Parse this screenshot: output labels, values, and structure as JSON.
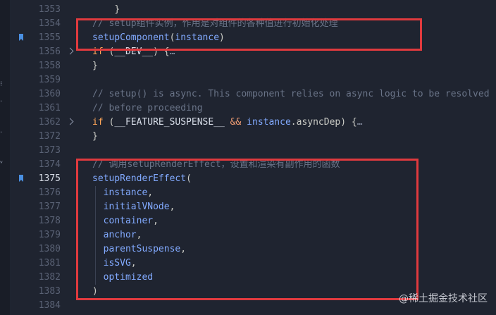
{
  "editor": {
    "lines": [
      {
        "num": "1353",
        "fold": false,
        "bookmark": false,
        "active": false,
        "tokens": [
          {
            "t": "    ",
            "c": "punct"
          },
          {
            "t": "}",
            "c": "punct"
          }
        ]
      },
      {
        "num": "1354",
        "fold": false,
        "bookmark": false,
        "active": false,
        "tokens": [
          {
            "t": "// setup组件实例，作用是对组件的各种值进行初始化处理",
            "c": "comment"
          }
        ]
      },
      {
        "num": "1355",
        "fold": false,
        "bookmark": true,
        "active": false,
        "tokens": [
          {
            "t": "setupComponent",
            "c": "fn"
          },
          {
            "t": "(",
            "c": "punct"
          },
          {
            "t": "instance",
            "c": "param"
          },
          {
            "t": ")",
            "c": "punct"
          }
        ]
      },
      {
        "num": "1356",
        "fold": true,
        "bookmark": false,
        "active": false,
        "tokens": [
          {
            "t": "if",
            "c": "kw"
          },
          {
            "t": " (",
            "c": "punct"
          },
          {
            "t": "__DEV__",
            "c": "const"
          },
          {
            "t": ") {",
            "c": "punct"
          },
          {
            "t": "…",
            "c": "ellipsis"
          }
        ]
      },
      {
        "num": "1358",
        "fold": false,
        "bookmark": false,
        "active": false,
        "tokens": [
          {
            "t": "}",
            "c": "punct"
          }
        ]
      },
      {
        "num": "1359",
        "fold": false,
        "bookmark": false,
        "active": false,
        "tokens": []
      },
      {
        "num": "1360",
        "fold": false,
        "bookmark": false,
        "active": false,
        "tokens": [
          {
            "t": "// setup() is async. This component relies on async logic to be resolved",
            "c": "comment"
          }
        ]
      },
      {
        "num": "1361",
        "fold": false,
        "bookmark": false,
        "active": false,
        "tokens": [
          {
            "t": "// before proceeding",
            "c": "comment"
          }
        ]
      },
      {
        "num": "1362",
        "fold": true,
        "bookmark": false,
        "active": false,
        "tokens": [
          {
            "t": "if",
            "c": "kw"
          },
          {
            "t": " (",
            "c": "punct"
          },
          {
            "t": "__FEATURE_SUSPENSE__",
            "c": "const"
          },
          {
            "t": " && ",
            "c": "op"
          },
          {
            "t": "instance",
            "c": "param"
          },
          {
            "t": ".asyncDep) {",
            "c": "punct"
          },
          {
            "t": "…",
            "c": "ellipsis"
          }
        ]
      },
      {
        "num": "1372",
        "fold": false,
        "bookmark": false,
        "active": false,
        "tokens": [
          {
            "t": "}",
            "c": "punct"
          }
        ]
      },
      {
        "num": "1373",
        "fold": false,
        "bookmark": false,
        "active": false,
        "tokens": []
      },
      {
        "num": "1374",
        "fold": false,
        "bookmark": false,
        "active": false,
        "tokens": [
          {
            "t": "// 调用setupRenderEffect，设置和渲染有副作用的函数",
            "c": "comment"
          }
        ]
      },
      {
        "num": "1375",
        "fold": false,
        "bookmark": true,
        "active": true,
        "tokens": [
          {
            "t": "setupRenderEffect",
            "c": "fn"
          },
          {
            "t": "(",
            "c": "punct"
          }
        ]
      },
      {
        "num": "1376",
        "fold": false,
        "bookmark": false,
        "active": false,
        "indent": true,
        "tokens": [
          {
            "t": "  instance",
            "c": "param"
          },
          {
            "t": ",",
            "c": "punct"
          }
        ]
      },
      {
        "num": "1377",
        "fold": false,
        "bookmark": false,
        "active": false,
        "indent": true,
        "tokens": [
          {
            "t": "  initialVNode",
            "c": "param"
          },
          {
            "t": ",",
            "c": "punct"
          }
        ]
      },
      {
        "num": "1378",
        "fold": false,
        "bookmark": false,
        "active": false,
        "indent": true,
        "tokens": [
          {
            "t": "  container",
            "c": "param"
          },
          {
            "t": ",",
            "c": "punct"
          }
        ]
      },
      {
        "num": "1379",
        "fold": false,
        "bookmark": false,
        "active": false,
        "indent": true,
        "tokens": [
          {
            "t": "  anchor",
            "c": "param"
          },
          {
            "t": ",",
            "c": "punct"
          }
        ]
      },
      {
        "num": "1380",
        "fold": false,
        "bookmark": false,
        "active": false,
        "indent": true,
        "tokens": [
          {
            "t": "  parentSuspense",
            "c": "param"
          },
          {
            "t": ",",
            "c": "punct"
          }
        ]
      },
      {
        "num": "1381",
        "fold": false,
        "bookmark": false,
        "active": false,
        "indent": true,
        "tokens": [
          {
            "t": "  isSVG",
            "c": "param"
          },
          {
            "t": ",",
            "c": "punct"
          }
        ]
      },
      {
        "num": "1382",
        "fold": false,
        "bookmark": false,
        "active": false,
        "indent": true,
        "tokens": [
          {
            "t": "  optimized",
            "c": "param"
          }
        ]
      },
      {
        "num": "1383",
        "fold": false,
        "bookmark": false,
        "active": false,
        "tokens": [
          {
            "t": ")",
            "c": "punct"
          }
        ]
      },
      {
        "num": "1384",
        "fold": false,
        "bookmark": false,
        "active": false,
        "tokens": []
      }
    ]
  },
  "activity_bar": {
    "glyphs": [
      "⁝",
      "·",
      "·",
      "ᵛ"
    ]
  },
  "watermark": "@稀土掘金技术社区",
  "colors": {
    "highlight_box": "#e03a3e",
    "bookmark": "#4a90e2",
    "background": "#1f2430"
  }
}
